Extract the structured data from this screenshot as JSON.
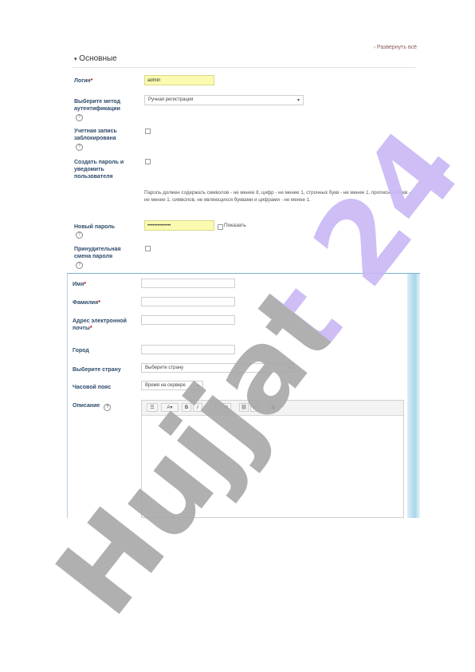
{
  "top_section": {
    "expand_all": "Развернуть всё",
    "section_title": "Основные",
    "login_label": "Логин",
    "login_value": "admin",
    "auth_label": "Выберите метод аутентификации",
    "auth_value": "Ручная регистрация",
    "suspended_label": "Учетная запись заблокирована",
    "create_password_label": "Создать пароль и уведомить пользователя",
    "password_hint": "Пароль должен содержать символов - не менее 8, цифр - не менее 1, строчных букв - не менее 1, прописных букв - не менее 1, символов, не являющихся буквами и цифрами - не менее 1.",
    "new_password_label": "Новый пароль",
    "new_password_value": "••••••••••••••",
    "show_label": "Показать",
    "force_change_label": "Принудительная смена пароля"
  },
  "bottom_section": {
    "firstname_label": "Имя",
    "lastname_label": "Фамилия",
    "email_label": "Адрес электронной почты",
    "city_label": "Город",
    "country_label": "Выберите страну",
    "country_value": "Выберите страну",
    "timezone_label": "Часовой пояс",
    "timezone_value": "Время на сервере",
    "description_label": "Описание"
  },
  "required_mark": "*",
  "help_symbol": "?",
  "watermark": "Hujjat 24",
  "colors": {
    "label_text": "#2e4a6b",
    "required": "#c00000",
    "highlight_input": "#fbfbb0",
    "watermark_gray": "#a8a8a8",
    "watermark_violet": "#c9b8f5",
    "panel_border": "#7ab0d0"
  },
  "icons": [
    "help-icon",
    "checkbox-icon",
    "chevron-down-icon",
    "toolbar-icons",
    "bold-icon",
    "italic-icon",
    "list-icon",
    "link-icon",
    "image-icon"
  ]
}
